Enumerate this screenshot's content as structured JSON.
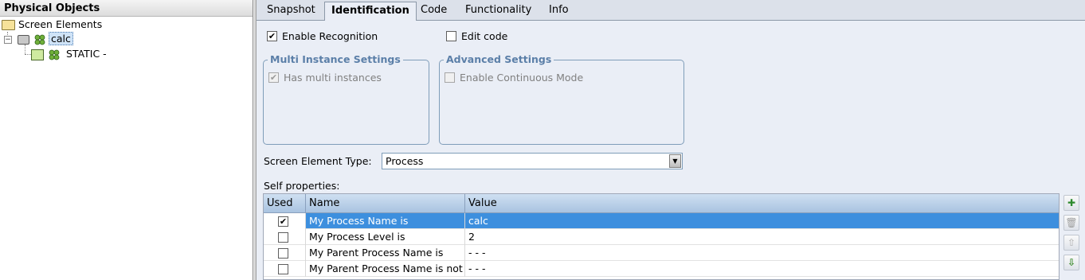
{
  "left_panel": {
    "title": "Physical Objects",
    "root": "Screen Elements",
    "node_calc": "calc",
    "node_static": "STATIC -",
    "expander": "−"
  },
  "tabs": [
    "Snapshot",
    "Identification",
    "Code",
    "Functionality",
    "Info"
  ],
  "active_tab": "Identification",
  "enable_recognition": {
    "label": "Enable Recognition",
    "checked": true,
    "mark": "✔"
  },
  "edit_code": {
    "label": "Edit code",
    "checked": false
  },
  "multi_instance": {
    "title": "Multi Instance Settings",
    "has_multi_label": "Has multi instances",
    "mark": "✔"
  },
  "advanced": {
    "title": "Advanced Settings",
    "continuous_label": "Enable Continuous Mode"
  },
  "screen_element_type": {
    "label": "Screen Element Type:",
    "value": "Process",
    "arrow": "▼"
  },
  "self_properties_label": "Self properties:",
  "table": {
    "headers": [
      "Used",
      "Name",
      "Value"
    ],
    "rows": [
      {
        "used": "✔",
        "name": "My Process Name is",
        "value": "calc"
      },
      {
        "used": "",
        "name": "My Process Level is",
        "value": "2"
      },
      {
        "used": "",
        "name": "My Parent Process Name is",
        "value": "- - -"
      },
      {
        "used": "",
        "name": "My Parent Process Name is not",
        "value": "- - -"
      }
    ]
  },
  "side_tools": [
    {
      "icon": "add-property-icon",
      "glyph": "✚"
    },
    {
      "icon": "trash-icon",
      "glyph": "🗑"
    },
    {
      "icon": "arrow-up-icon",
      "glyph": "⇧"
    },
    {
      "icon": "arrow-down-icon",
      "glyph": "⇩"
    }
  ],
  "colors": {
    "selected_row": "#3d8fde",
    "group_title": "#5b7fa8",
    "panel_bg": "#eaeef6"
  }
}
